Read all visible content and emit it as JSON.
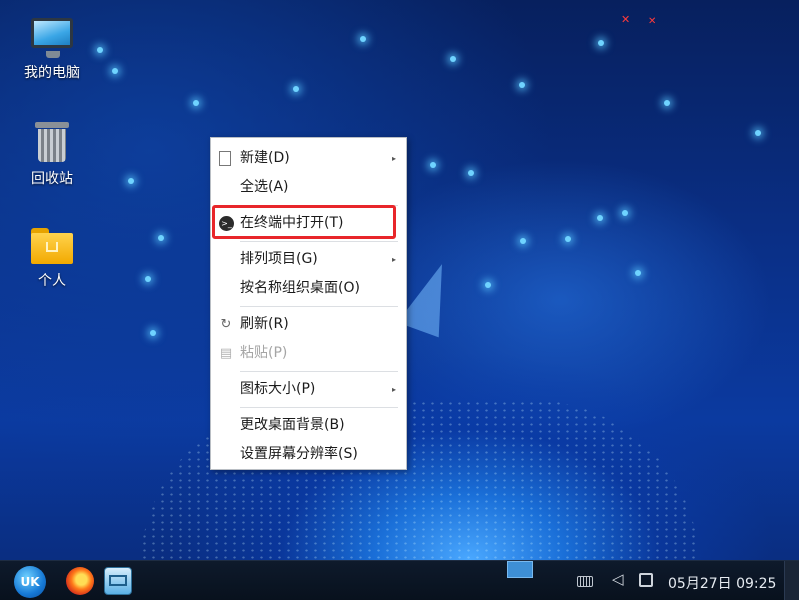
{
  "desktop": {
    "icons": [
      {
        "label": "我的电脑",
        "icon": "computer-icon"
      },
      {
        "label": "回收站",
        "icon": "trash-icon"
      },
      {
        "label": "个人",
        "icon": "home-folder-icon"
      }
    ]
  },
  "context_menu": {
    "items": [
      {
        "label": "新建(D)",
        "icon": "document-icon",
        "submenu": true
      },
      {
        "label": "全选(A)"
      },
      {
        "label": "在终端中打开(T)",
        "icon": "terminal-icon",
        "highlighted": true
      },
      {
        "label": "排列项目(G)",
        "submenu": true
      },
      {
        "label": "按名称组织桌面(O)"
      },
      {
        "label": "刷新(R)",
        "icon": "refresh-icon"
      },
      {
        "label": "粘贴(P)",
        "icon": "paste-icon",
        "disabled": true
      },
      {
        "label": "图标大小(P)",
        "submenu": true
      },
      {
        "label": "更改桌面背景(B)"
      },
      {
        "label": "设置屏幕分辨率(S)"
      }
    ],
    "highlight_color": "#e8262a"
  },
  "taskbar": {
    "start_label": "UK",
    "clock": "05月27日 09:25"
  },
  "icons": {
    "submenu_arrow": "▸",
    "terminal_glyph": ">_",
    "refresh_glyph": "↻",
    "paste_glyph": "▤",
    "volume_glyph": "◁",
    "muted_glyph": "✕"
  }
}
